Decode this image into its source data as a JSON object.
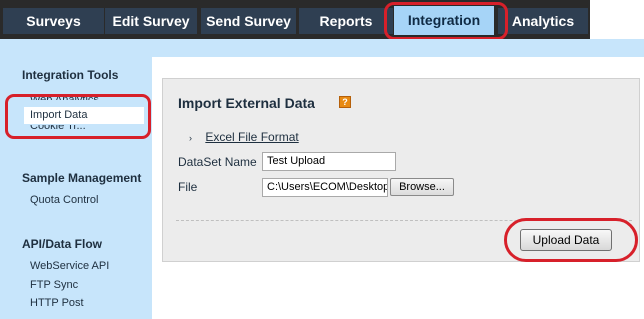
{
  "tabs": [
    {
      "label": "Surveys"
    },
    {
      "label": "Edit Survey"
    },
    {
      "label": "Send Survey"
    },
    {
      "label": "Reports"
    },
    {
      "label": "Integration"
    },
    {
      "label": "Analytics"
    }
  ],
  "sidebar": {
    "sections": [
      {
        "heading": "Integration Tools",
        "items": [
          "Web Analytics",
          "Import Data",
          "Cookie Tr..."
        ]
      },
      {
        "heading": "Sample Management",
        "items": [
          "Quota Control"
        ]
      },
      {
        "heading": "API/Data Flow",
        "items": [
          "WebService API",
          "FTP Sync",
          "HTTP Post"
        ]
      }
    ]
  },
  "main": {
    "title": "Import External Data",
    "help_icon": "?",
    "link_arrow": "›",
    "format_link": "Excel File Format",
    "dataset_label": "DataSet Name",
    "dataset_value": "Test Upload",
    "file_label": "File",
    "file_value": "C:\\Users\\ECOM\\Desktop",
    "browse_label": "Browse...",
    "upload_label": "Upload Data"
  },
  "colors": {
    "accent_highlight": "#d7202a",
    "tab_dark": "#2f3f52",
    "tab_active": "#a6d4f7",
    "sidebar_bg": "#c7e5fb"
  }
}
